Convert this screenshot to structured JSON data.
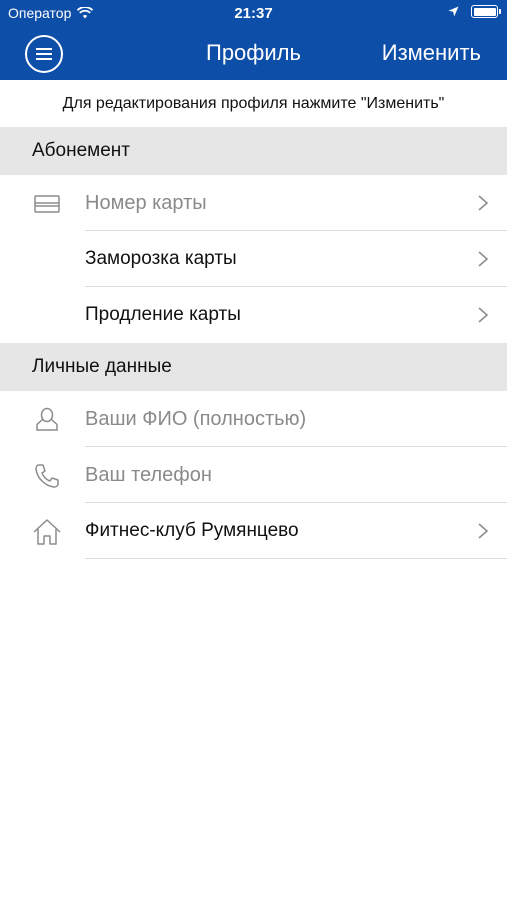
{
  "status_bar": {
    "carrier": "Оператор",
    "time": "21:37"
  },
  "nav": {
    "title": "Профиль",
    "edit_label": "Изменить"
  },
  "hint": "Для редактирования профиля нажмите \"Изменить\"",
  "sections": {
    "subscription": {
      "title": "Абонемент",
      "card_number_placeholder": "Номер карты",
      "freeze_label": "Заморозка карты",
      "extend_label": "Продление карты"
    },
    "personal": {
      "title": "Личные данные",
      "name_placeholder": "Ваши ФИО (полностью)",
      "phone_placeholder": "Ваш телефон",
      "club_label": "Фитнес-клуб Румянцево"
    }
  },
  "colors": {
    "brand": "#0d4ea8",
    "section_bg": "#e6e6e6",
    "placeholder": "#8a8a8a"
  }
}
